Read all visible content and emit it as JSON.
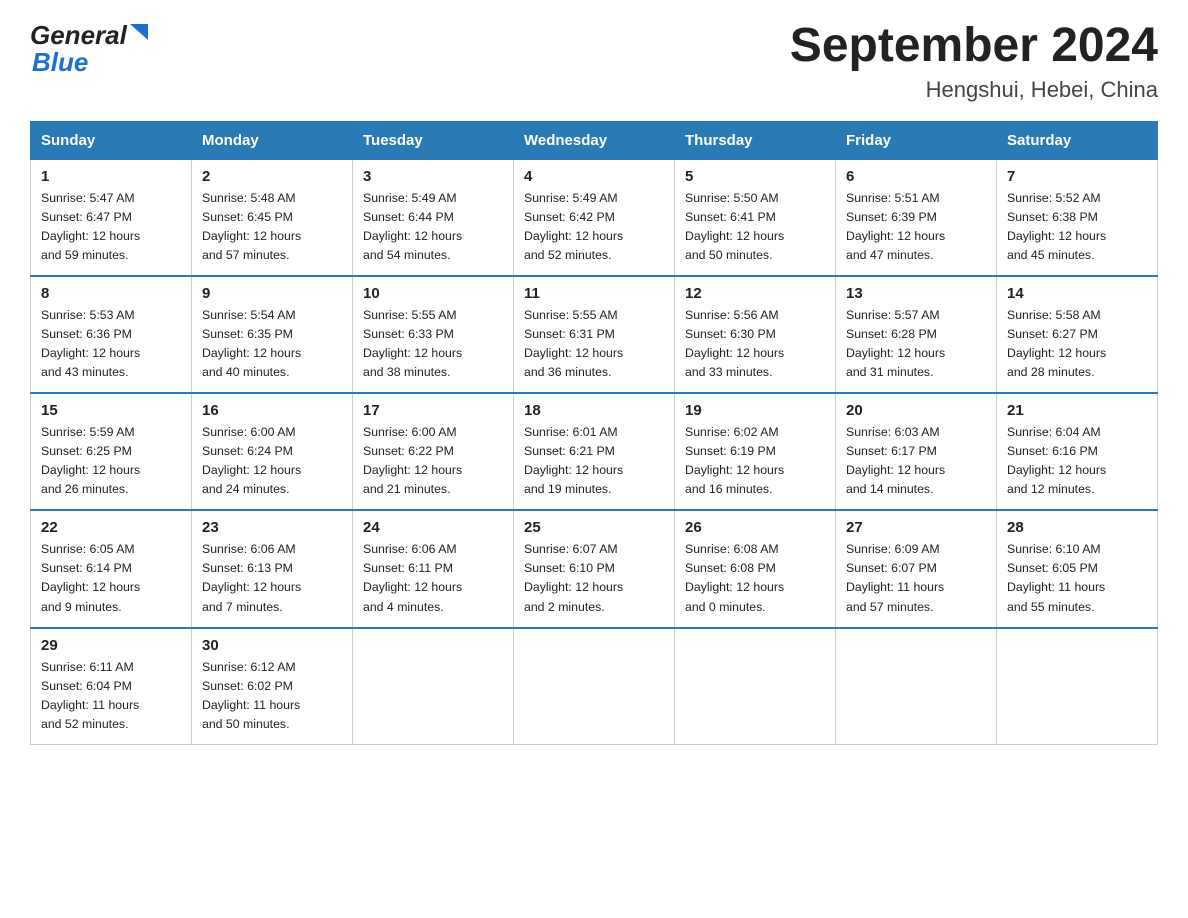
{
  "header": {
    "title": "September 2024",
    "subtitle": "Hengshui, Hebei, China",
    "logo_general": "General",
    "logo_blue": "Blue"
  },
  "weekdays": [
    "Sunday",
    "Monday",
    "Tuesday",
    "Wednesday",
    "Thursday",
    "Friday",
    "Saturday"
  ],
  "weeks": [
    [
      {
        "day": "1",
        "sunrise": "5:47 AM",
        "sunset": "6:47 PM",
        "daylight": "12 hours and 59 minutes."
      },
      {
        "day": "2",
        "sunrise": "5:48 AM",
        "sunset": "6:45 PM",
        "daylight": "12 hours and 57 minutes."
      },
      {
        "day": "3",
        "sunrise": "5:49 AM",
        "sunset": "6:44 PM",
        "daylight": "12 hours and 54 minutes."
      },
      {
        "day": "4",
        "sunrise": "5:49 AM",
        "sunset": "6:42 PM",
        "daylight": "12 hours and 52 minutes."
      },
      {
        "day": "5",
        "sunrise": "5:50 AM",
        "sunset": "6:41 PM",
        "daylight": "12 hours and 50 minutes."
      },
      {
        "day": "6",
        "sunrise": "5:51 AM",
        "sunset": "6:39 PM",
        "daylight": "12 hours and 47 minutes."
      },
      {
        "day": "7",
        "sunrise": "5:52 AM",
        "sunset": "6:38 PM",
        "daylight": "12 hours and 45 minutes."
      }
    ],
    [
      {
        "day": "8",
        "sunrise": "5:53 AM",
        "sunset": "6:36 PM",
        "daylight": "12 hours and 43 minutes."
      },
      {
        "day": "9",
        "sunrise": "5:54 AM",
        "sunset": "6:35 PM",
        "daylight": "12 hours and 40 minutes."
      },
      {
        "day": "10",
        "sunrise": "5:55 AM",
        "sunset": "6:33 PM",
        "daylight": "12 hours and 38 minutes."
      },
      {
        "day": "11",
        "sunrise": "5:55 AM",
        "sunset": "6:31 PM",
        "daylight": "12 hours and 36 minutes."
      },
      {
        "day": "12",
        "sunrise": "5:56 AM",
        "sunset": "6:30 PM",
        "daylight": "12 hours and 33 minutes."
      },
      {
        "day": "13",
        "sunrise": "5:57 AM",
        "sunset": "6:28 PM",
        "daylight": "12 hours and 31 minutes."
      },
      {
        "day": "14",
        "sunrise": "5:58 AM",
        "sunset": "6:27 PM",
        "daylight": "12 hours and 28 minutes."
      }
    ],
    [
      {
        "day": "15",
        "sunrise": "5:59 AM",
        "sunset": "6:25 PM",
        "daylight": "12 hours and 26 minutes."
      },
      {
        "day": "16",
        "sunrise": "6:00 AM",
        "sunset": "6:24 PM",
        "daylight": "12 hours and 24 minutes."
      },
      {
        "day": "17",
        "sunrise": "6:00 AM",
        "sunset": "6:22 PM",
        "daylight": "12 hours and 21 minutes."
      },
      {
        "day": "18",
        "sunrise": "6:01 AM",
        "sunset": "6:21 PM",
        "daylight": "12 hours and 19 minutes."
      },
      {
        "day": "19",
        "sunrise": "6:02 AM",
        "sunset": "6:19 PM",
        "daylight": "12 hours and 16 minutes."
      },
      {
        "day": "20",
        "sunrise": "6:03 AM",
        "sunset": "6:17 PM",
        "daylight": "12 hours and 14 minutes."
      },
      {
        "day": "21",
        "sunrise": "6:04 AM",
        "sunset": "6:16 PM",
        "daylight": "12 hours and 12 minutes."
      }
    ],
    [
      {
        "day": "22",
        "sunrise": "6:05 AM",
        "sunset": "6:14 PM",
        "daylight": "12 hours and 9 minutes."
      },
      {
        "day": "23",
        "sunrise": "6:06 AM",
        "sunset": "6:13 PM",
        "daylight": "12 hours and 7 minutes."
      },
      {
        "day": "24",
        "sunrise": "6:06 AM",
        "sunset": "6:11 PM",
        "daylight": "12 hours and 4 minutes."
      },
      {
        "day": "25",
        "sunrise": "6:07 AM",
        "sunset": "6:10 PM",
        "daylight": "12 hours and 2 minutes."
      },
      {
        "day": "26",
        "sunrise": "6:08 AM",
        "sunset": "6:08 PM",
        "daylight": "12 hours and 0 minutes."
      },
      {
        "day": "27",
        "sunrise": "6:09 AM",
        "sunset": "6:07 PM",
        "daylight": "11 hours and 57 minutes."
      },
      {
        "day": "28",
        "sunrise": "6:10 AM",
        "sunset": "6:05 PM",
        "daylight": "11 hours and 55 minutes."
      }
    ],
    [
      {
        "day": "29",
        "sunrise": "6:11 AM",
        "sunset": "6:04 PM",
        "daylight": "11 hours and 52 minutes."
      },
      {
        "day": "30",
        "sunrise": "6:12 AM",
        "sunset": "6:02 PM",
        "daylight": "11 hours and 50 minutes."
      },
      null,
      null,
      null,
      null,
      null
    ]
  ],
  "labels": {
    "sunrise": "Sunrise:",
    "sunset": "Sunset:",
    "daylight": "Daylight:"
  }
}
